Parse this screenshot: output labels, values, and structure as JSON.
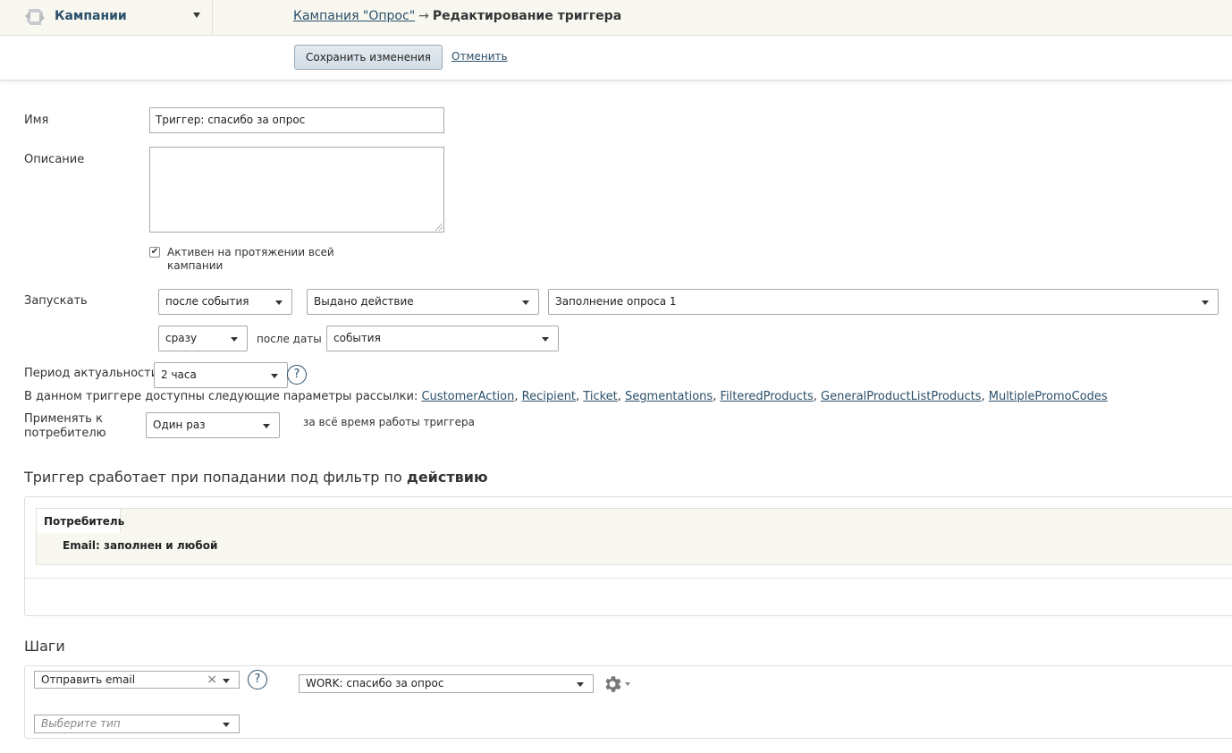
{
  "header": {
    "section_title": "Кампании",
    "breadcrumb_link": "Кампания \"Опрос\"",
    "breadcrumb_arrow": "→",
    "breadcrumb_current": "Редактирование триггера"
  },
  "toolbar": {
    "save_label": "Сохранить изменения",
    "cancel_label": "Отменить"
  },
  "form": {
    "name_label": "Имя",
    "name_value": "Триггер: спасибо за опрос",
    "description_label": "Описание",
    "description_value": "",
    "active_checked": true,
    "active_label_line1": "Активен на протяжении всей",
    "active_label_line2": "кампании",
    "launch_label": "Запускать",
    "launch_when": "после события",
    "launch_event": "Выдано действие",
    "launch_action": "Заполнение опроса 1",
    "delay": "сразу",
    "after_date_label": "после даты",
    "after_date_value": "события",
    "period_label": "Период актуальности",
    "period_value": "2 часа",
    "help_glyph": "?",
    "params_prefix": "В данном триггере доступны следующие параметры рассылки:",
    "params": [
      "CustomerAction",
      "Recipient",
      "Ticket",
      "Segmentations",
      "FilteredProducts",
      "GeneralProductListProducts",
      "MultiplePromoCodes"
    ],
    "apply_label_line1": "Применять к",
    "apply_label_line2": "потребителю",
    "apply_value": "Один раз",
    "apply_suffix": "за всё время работы триггера"
  },
  "filter": {
    "heading_prefix": "Триггер сработает при попадании под фильтр по",
    "heading_bold": "действию",
    "tab_label": "Потребитель",
    "condition": "Email: заполнен и любой"
  },
  "steps": {
    "heading": "Шаги",
    "step_type": "Отправить email",
    "clear_glyph": "×",
    "template": "WORK: спасибо за опрос",
    "type_placeholder": "Выберите тип"
  },
  "colors": {
    "link": "#2a4f6a",
    "topbar_bg": "#f8f8f1",
    "button_bg": "#dbe4ec"
  }
}
